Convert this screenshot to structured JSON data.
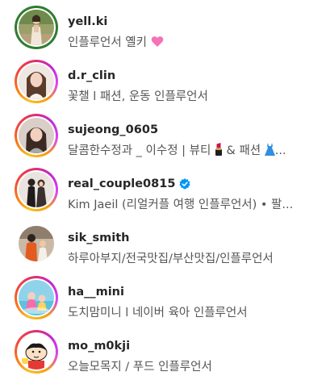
{
  "colors": {
    "username": "#262626",
    "bio": "#555555",
    "verified": "#0095f6",
    "seen_ring": "#2e7d32"
  },
  "accounts": [
    {
      "username": "yell.ki",
      "bio": "인플루언서 옐키",
      "bio_emoji": "pink-heart-icon",
      "ring": "seen",
      "verified": false
    },
    {
      "username": "d.r_clin",
      "bio": "꽃챌 l 패션, 운동 인플루언서",
      "ring": "story",
      "verified": false
    },
    {
      "username": "sujeong_0605",
      "bio_parts": [
        "달콤한수정과 _ 이수정 | 뷰티 ",
        " & 패션 ",
        "..."
      ],
      "ring": "story",
      "verified": false
    },
    {
      "username": "real_couple0815",
      "bio": "Kim Jaeil (리얼커플 여행 인플루언서) • 팔...",
      "ring": "story",
      "verified": true
    },
    {
      "username": "sik_smith",
      "bio": "하루아부지/전국맛집/부산맛집/인플루언서",
      "ring": "none",
      "verified": false
    },
    {
      "username": "ha__mini",
      "bio": "도치맘미니 l 네이버 육아 인플루언서",
      "ring": "story",
      "verified": false
    },
    {
      "username": "mo_m0kji",
      "bio": "오늘모목지 / 푸드 인플루언서",
      "ring": "story",
      "verified": false
    }
  ]
}
